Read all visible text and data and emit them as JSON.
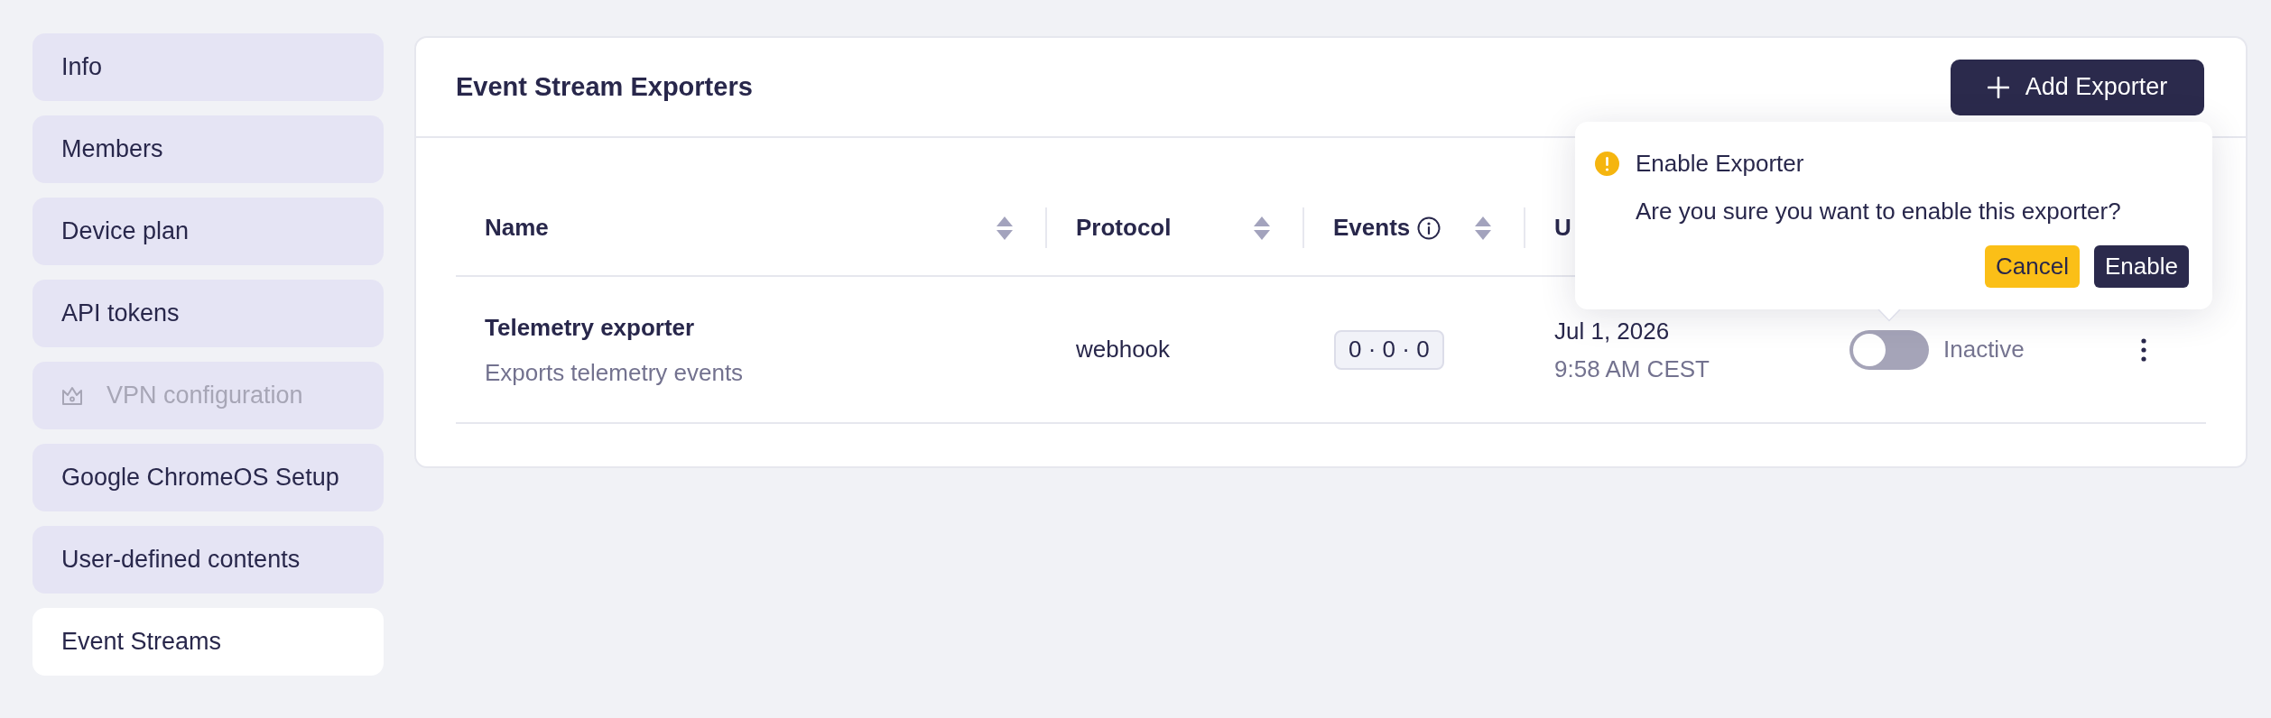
{
  "sidebar": {
    "items": [
      {
        "label": "Info",
        "selected": false,
        "disabled": false
      },
      {
        "label": "Members",
        "selected": false,
        "disabled": false
      },
      {
        "label": "Device plan",
        "selected": false,
        "disabled": false
      },
      {
        "label": "API tokens",
        "selected": false,
        "disabled": false
      },
      {
        "label": "VPN configuration",
        "selected": false,
        "disabled": true
      },
      {
        "label": "Google ChromeOS Setup",
        "selected": false,
        "disabled": false
      },
      {
        "label": "User-defined contents",
        "selected": false,
        "disabled": false
      },
      {
        "label": "Event Streams",
        "selected": true,
        "disabled": false
      }
    ]
  },
  "panel": {
    "title": "Event Stream Exporters",
    "add_button": "Add Exporter"
  },
  "table": {
    "columns": [
      {
        "label": "Name",
        "sortable": true,
        "info": false
      },
      {
        "label": "Protocol",
        "sortable": true,
        "info": false
      },
      {
        "label": "Events",
        "sortable": true,
        "info": true
      },
      {
        "label": "U",
        "sortable": false,
        "info": false
      }
    ],
    "rows": [
      {
        "name": "Telemetry exporter",
        "description": "Exports telemetry events",
        "protocol": "webhook",
        "events": "0 · 0 · 0",
        "date": "Jul 1, 2026",
        "time": "9:58 AM CEST",
        "active": false,
        "status": "Inactive"
      }
    ]
  },
  "popover": {
    "title": "Enable Exporter",
    "message": "Are you sure you want to enable this exporter?",
    "buttons": [
      {
        "label": "Cancel",
        "kind": "secondary"
      },
      {
        "label": "Enable",
        "kind": "primary"
      }
    ]
  }
}
